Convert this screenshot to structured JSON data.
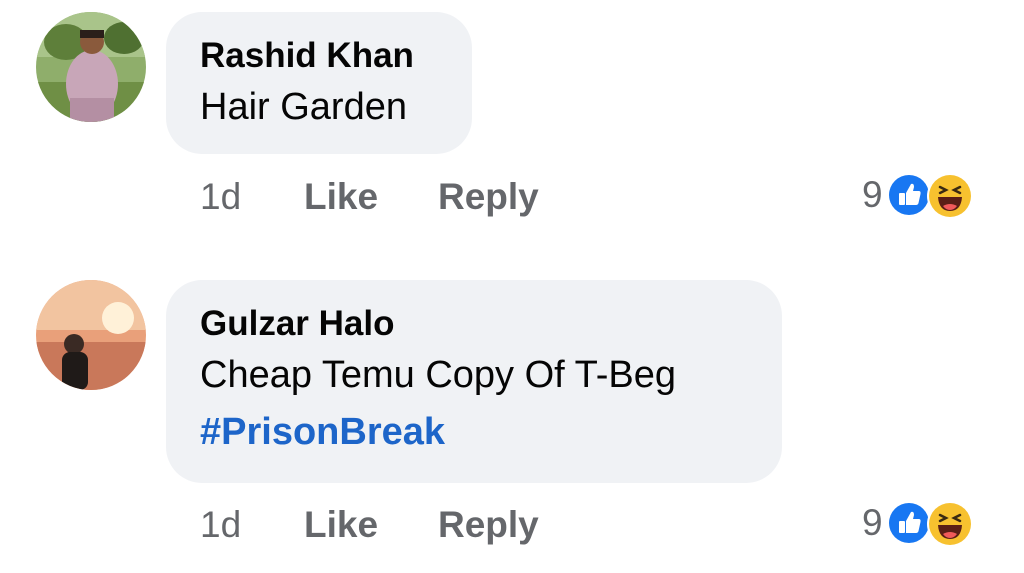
{
  "comments": [
    {
      "author": "Rashid Khan",
      "text": "Hair Garden",
      "hashtag": "",
      "age": "1d",
      "like_label": "Like",
      "reply_label": "Reply",
      "reaction_count": "9",
      "reactions": [
        "like-icon",
        "haha-icon"
      ]
    },
    {
      "author": "Gulzar Halo",
      "text": "Cheap Temu Copy Of T-Beg",
      "hashtag": "#PrisonBreak",
      "age": "1d",
      "like_label": "Like",
      "reply_label": "Reply",
      "reaction_count": "9",
      "reactions": [
        "like-icon",
        "haha-icon"
      ]
    }
  ],
  "colors": {
    "bubble": "#f0f2f5",
    "meta_text": "#65676b",
    "hashtag": "#1d65c9",
    "like_blue": "#1877f2",
    "haha_yellow": "#f7c12f"
  }
}
